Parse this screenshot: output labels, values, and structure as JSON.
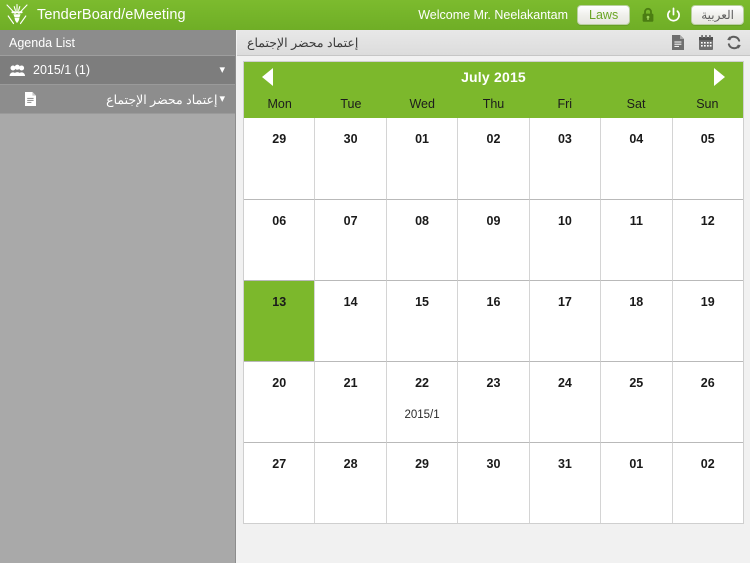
{
  "header": {
    "logo_icon": "oman-emblem-icon",
    "brand_title": "TenderBoard/eMeeting",
    "welcome": "Welcome Mr. Neelakantam",
    "laws_label": "Laws",
    "lock_icon": "lock-icon",
    "power_icon": "power-icon",
    "arabic_label": "العربية"
  },
  "sidebar": {
    "title": "Agenda List",
    "items": [
      {
        "icon": "group-users-icon",
        "label": "2015/1 (1)",
        "chevron": "▾",
        "rtl": false
      },
      {
        "icon": "document-icon",
        "label": "إعتماد محضر الإجتماع",
        "chevron": "▾",
        "rtl": true
      }
    ]
  },
  "content": {
    "title": "إعتماد محضر الإجتماع",
    "tools": [
      {
        "icon": "document-icon",
        "name": "document-view-button"
      },
      {
        "icon": "calendar-icon",
        "name": "calendar-view-button"
      },
      {
        "icon": "refresh-icon",
        "name": "refresh-button"
      }
    ]
  },
  "calendar": {
    "month_label": "July 2015",
    "prev_label": "◀",
    "next_label": "▶",
    "daynames": [
      "Mon",
      "Tue",
      "Wed",
      "Thu",
      "Fri",
      "Sat",
      "Sun"
    ],
    "weeks": [
      [
        {
          "day": "29",
          "other_month": true,
          "today": false,
          "event": ""
        },
        {
          "day": "30",
          "other_month": true,
          "today": false,
          "event": ""
        },
        {
          "day": "01",
          "other_month": false,
          "today": false,
          "event": ""
        },
        {
          "day": "02",
          "other_month": false,
          "today": false,
          "event": ""
        },
        {
          "day": "03",
          "other_month": false,
          "today": false,
          "event": ""
        },
        {
          "day": "04",
          "other_month": false,
          "today": false,
          "event": ""
        },
        {
          "day": "05",
          "other_month": false,
          "today": false,
          "event": ""
        }
      ],
      [
        {
          "day": "06",
          "other_month": false,
          "today": false,
          "event": ""
        },
        {
          "day": "07",
          "other_month": false,
          "today": false,
          "event": ""
        },
        {
          "day": "08",
          "other_month": false,
          "today": false,
          "event": ""
        },
        {
          "day": "09",
          "other_month": false,
          "today": false,
          "event": ""
        },
        {
          "day": "10",
          "other_month": false,
          "today": false,
          "event": ""
        },
        {
          "day": "11",
          "other_month": false,
          "today": false,
          "event": ""
        },
        {
          "day": "12",
          "other_month": false,
          "today": false,
          "event": ""
        }
      ],
      [
        {
          "day": "13",
          "other_month": false,
          "today": true,
          "event": ""
        },
        {
          "day": "14",
          "other_month": false,
          "today": false,
          "event": ""
        },
        {
          "day": "15",
          "other_month": false,
          "today": false,
          "event": ""
        },
        {
          "day": "16",
          "other_month": false,
          "today": false,
          "event": ""
        },
        {
          "day": "17",
          "other_month": false,
          "today": false,
          "event": ""
        },
        {
          "day": "18",
          "other_month": false,
          "today": false,
          "event": ""
        },
        {
          "day": "19",
          "other_month": false,
          "today": false,
          "event": ""
        }
      ],
      [
        {
          "day": "20",
          "other_month": false,
          "today": false,
          "event": ""
        },
        {
          "day": "21",
          "other_month": false,
          "today": false,
          "event": ""
        },
        {
          "day": "22",
          "other_month": false,
          "today": false,
          "event": "2015/1"
        },
        {
          "day": "23",
          "other_month": false,
          "today": false,
          "event": ""
        },
        {
          "day": "24",
          "other_month": false,
          "today": false,
          "event": ""
        },
        {
          "day": "25",
          "other_month": false,
          "today": false,
          "event": ""
        },
        {
          "day": "26",
          "other_month": false,
          "today": false,
          "event": ""
        }
      ],
      [
        {
          "day": "27",
          "other_month": false,
          "today": false,
          "event": ""
        },
        {
          "day": "28",
          "other_month": false,
          "today": false,
          "event": ""
        },
        {
          "day": "29",
          "other_month": false,
          "today": false,
          "event": ""
        },
        {
          "day": "30",
          "other_month": false,
          "today": false,
          "event": ""
        },
        {
          "day": "31",
          "other_month": false,
          "today": false,
          "event": ""
        },
        {
          "day": "01",
          "other_month": true,
          "today": false,
          "event": ""
        },
        {
          "day": "02",
          "other_month": true,
          "today": false,
          "event": ""
        }
      ]
    ]
  },
  "colors": {
    "brand_green": "#7cb82c",
    "header_green": "#76b52a",
    "sidebar_grey": "#a9a9a9",
    "sidebar_row_dark": "#7d7d7d",
    "sidebar_row_light": "#8d8d8d",
    "content_bg": "#f1f1f1",
    "today_green": "#7cb82c"
  }
}
